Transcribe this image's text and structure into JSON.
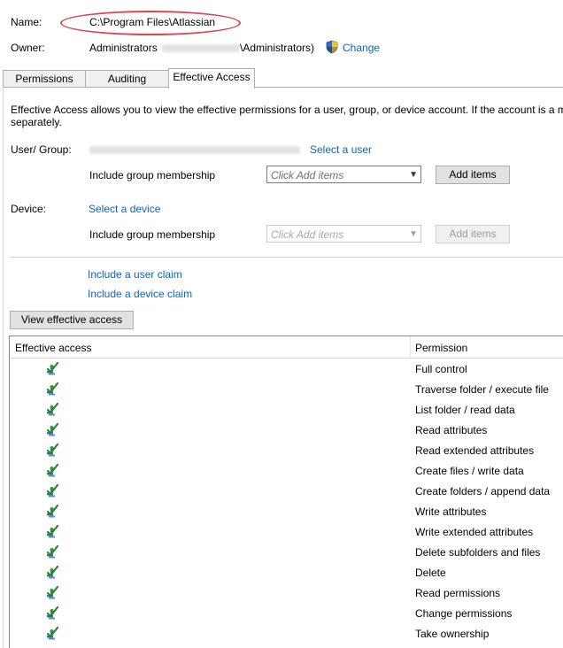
{
  "header": {
    "name_label": "Name:",
    "name_value": "C:\\Program Files\\Atlassian",
    "owner_label": "Owner:",
    "owner_value_prefix": "Administrators",
    "owner_value_suffix": "\\Administrators)",
    "change_link": "Change"
  },
  "tabs": [
    "Permissions",
    "Auditing",
    "Effective Access"
  ],
  "description": "Effective Access allows you to view the effective permissions for a user, group, or device account. If the account is a me",
  "description_line2": "separately.",
  "user_group": {
    "label": "User/ Group:",
    "select_link": "Select a user",
    "membership_label": "Include group membership",
    "combo_placeholder": "Click Add items",
    "add_button": "Add items"
  },
  "device": {
    "label": "Device:",
    "select_link": "Select a device",
    "membership_label": "Include group membership",
    "combo_placeholder": "Click Add items",
    "add_button": "Add items"
  },
  "claims": {
    "user_claim": "Include a user claim",
    "device_claim": "Include a device claim"
  },
  "view_button": "View effective access",
  "table": {
    "col_access": "Effective access",
    "col_permission": "Permission",
    "rows": [
      "Full control",
      "Traverse folder / execute file",
      "List folder / read data",
      "Read attributes",
      "Read extended attributes",
      "Create files / write data",
      "Create folders / append data",
      "Write attributes",
      "Write extended attributes",
      "Delete subfolders and files",
      "Delete",
      "Read permissions",
      "Change permissions",
      "Take ownership"
    ]
  },
  "colors": {
    "link": "#0b62c4",
    "highlight_oval": "#d9474f"
  },
  "icons": {
    "shield": "uac-shield-icon",
    "access": "allowed-access-icon"
  }
}
